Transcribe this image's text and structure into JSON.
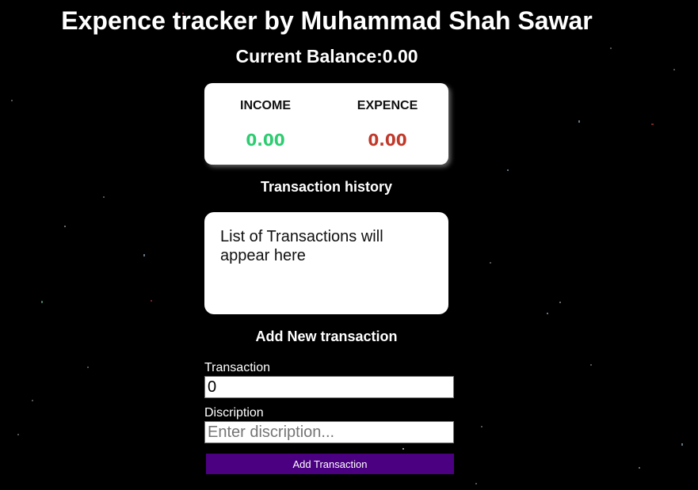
{
  "header": {
    "title": "Expence tracker by Muhammad Shah Sawar",
    "balance_label": "Current Balance:",
    "balance_value": "0.00"
  },
  "summary": {
    "income_label": "INCOME",
    "income_value": "0.00",
    "expense_label": "EXPENCE",
    "expense_value": "0.00"
  },
  "history": {
    "heading": "Transaction history",
    "placeholder": "List of Transactions will appear here"
  },
  "form": {
    "heading": "Add New transaction",
    "amount_label": "Transaction",
    "amount_value": "0",
    "description_label": "Discription",
    "description_placeholder": "Enter discription...",
    "submit_label": "Add Transaction"
  },
  "colors": {
    "background": "#000000",
    "income": "#2ecc71",
    "expense": "#c0392b",
    "button": "#4b0082"
  }
}
